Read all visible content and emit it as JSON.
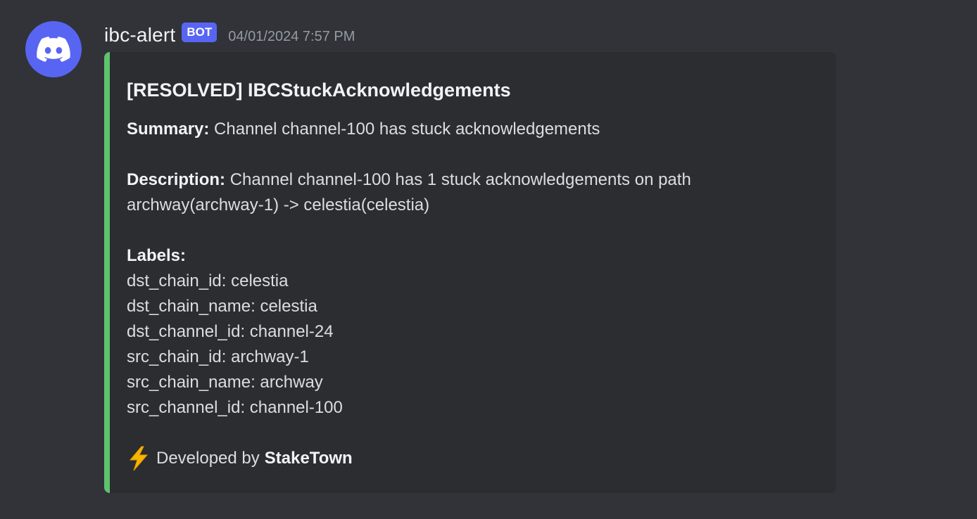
{
  "message": {
    "author": "ibc-alert",
    "bot_tag": "BOT",
    "timestamp": "04/01/2024 7:57 PM",
    "avatar_icon": "discord-logo-icon"
  },
  "embed": {
    "accent_color": "#5ec46d",
    "title": "[RESOLVED] IBCStuckAcknowledgements",
    "summary_label": "Summary:",
    "summary_text": "Channel channel-100 has stuck acknowledgements",
    "description_label": "Description:",
    "description_line1": "Channel channel-100 has 1 stuck acknowledgements on path",
    "description_line2": "archway(archway-1) -> celestia(celestia)",
    "labels_heading": "Labels:",
    "labels": [
      "dst_chain_id: celestia",
      "dst_chain_name: celestia",
      "dst_channel_id: channel-24",
      "src_chain_id: archway-1",
      "src_chain_name: archway",
      "src_channel_id: channel-100"
    ],
    "footer_icon": "lightning-bolt-icon",
    "footer_prefix": "Developed by",
    "footer_brand": "StakeTown"
  },
  "colors": {
    "background": "#313338",
    "embed_background": "#2b2d31",
    "blurple": "#5865f2",
    "timestamp": "#949ba4"
  }
}
